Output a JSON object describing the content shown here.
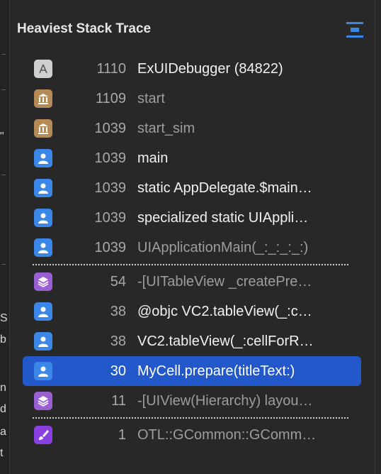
{
  "left_fragments": [
    "\"",
    "S",
    "b",
    "n",
    "d",
    "a",
    "t"
  ],
  "panel": {
    "title": "Heaviest Stack Trace",
    "header_icon": "stack-layout-icon"
  },
  "rows": [
    {
      "count": "1110",
      "name": "ExUIDebugger (84822)",
      "icon": "app-icon",
      "tone": "strong"
    },
    {
      "count": "1109",
      "name": "start",
      "icon": "library-icon",
      "tone": "dim"
    },
    {
      "count": "1039",
      "name": "start_sim",
      "icon": "library-icon",
      "tone": "dim"
    },
    {
      "count": "1039",
      "name": "main",
      "icon": "user-icon",
      "tone": "strong"
    },
    {
      "count": "1039",
      "name": "static AppDelegate.$main…",
      "icon": "user-icon",
      "tone": "strong"
    },
    {
      "count": "1039",
      "name": "specialized static UIAppli…",
      "icon": "user-icon",
      "tone": "strong"
    },
    {
      "count": "1039",
      "name": "UIApplicationMain(_:_:_:_:)",
      "icon": "user-icon",
      "tone": "dim"
    },
    {
      "count": "54",
      "name": "-[UITableView _createPre…",
      "icon": "layers-icon",
      "tone": "dim"
    },
    {
      "count": "38",
      "name": "@objc VC2.tableView(_:c…",
      "icon": "user-icon",
      "tone": "strong"
    },
    {
      "count": "38",
      "name": "VC2.tableView(_:cellForR…",
      "icon": "user-icon",
      "tone": "strong"
    },
    {
      "count": "30",
      "name": "MyCell.prepare(titleText:)",
      "icon": "user-icon",
      "tone": "strong",
      "selected": true
    },
    {
      "count": "11",
      "name": "-[UIView(Hierarchy) layou…",
      "icon": "layers-icon",
      "tone": "dim"
    },
    {
      "count": "1",
      "name": "OTL::GCommon::GComm…",
      "icon": "brush-icon",
      "tone": "dim"
    }
  ],
  "colors": {
    "selection": "#2258c9",
    "user_icon": "#3b87e8",
    "library_icon": "#b58a57",
    "framework_icon": "#9b5fd4"
  }
}
